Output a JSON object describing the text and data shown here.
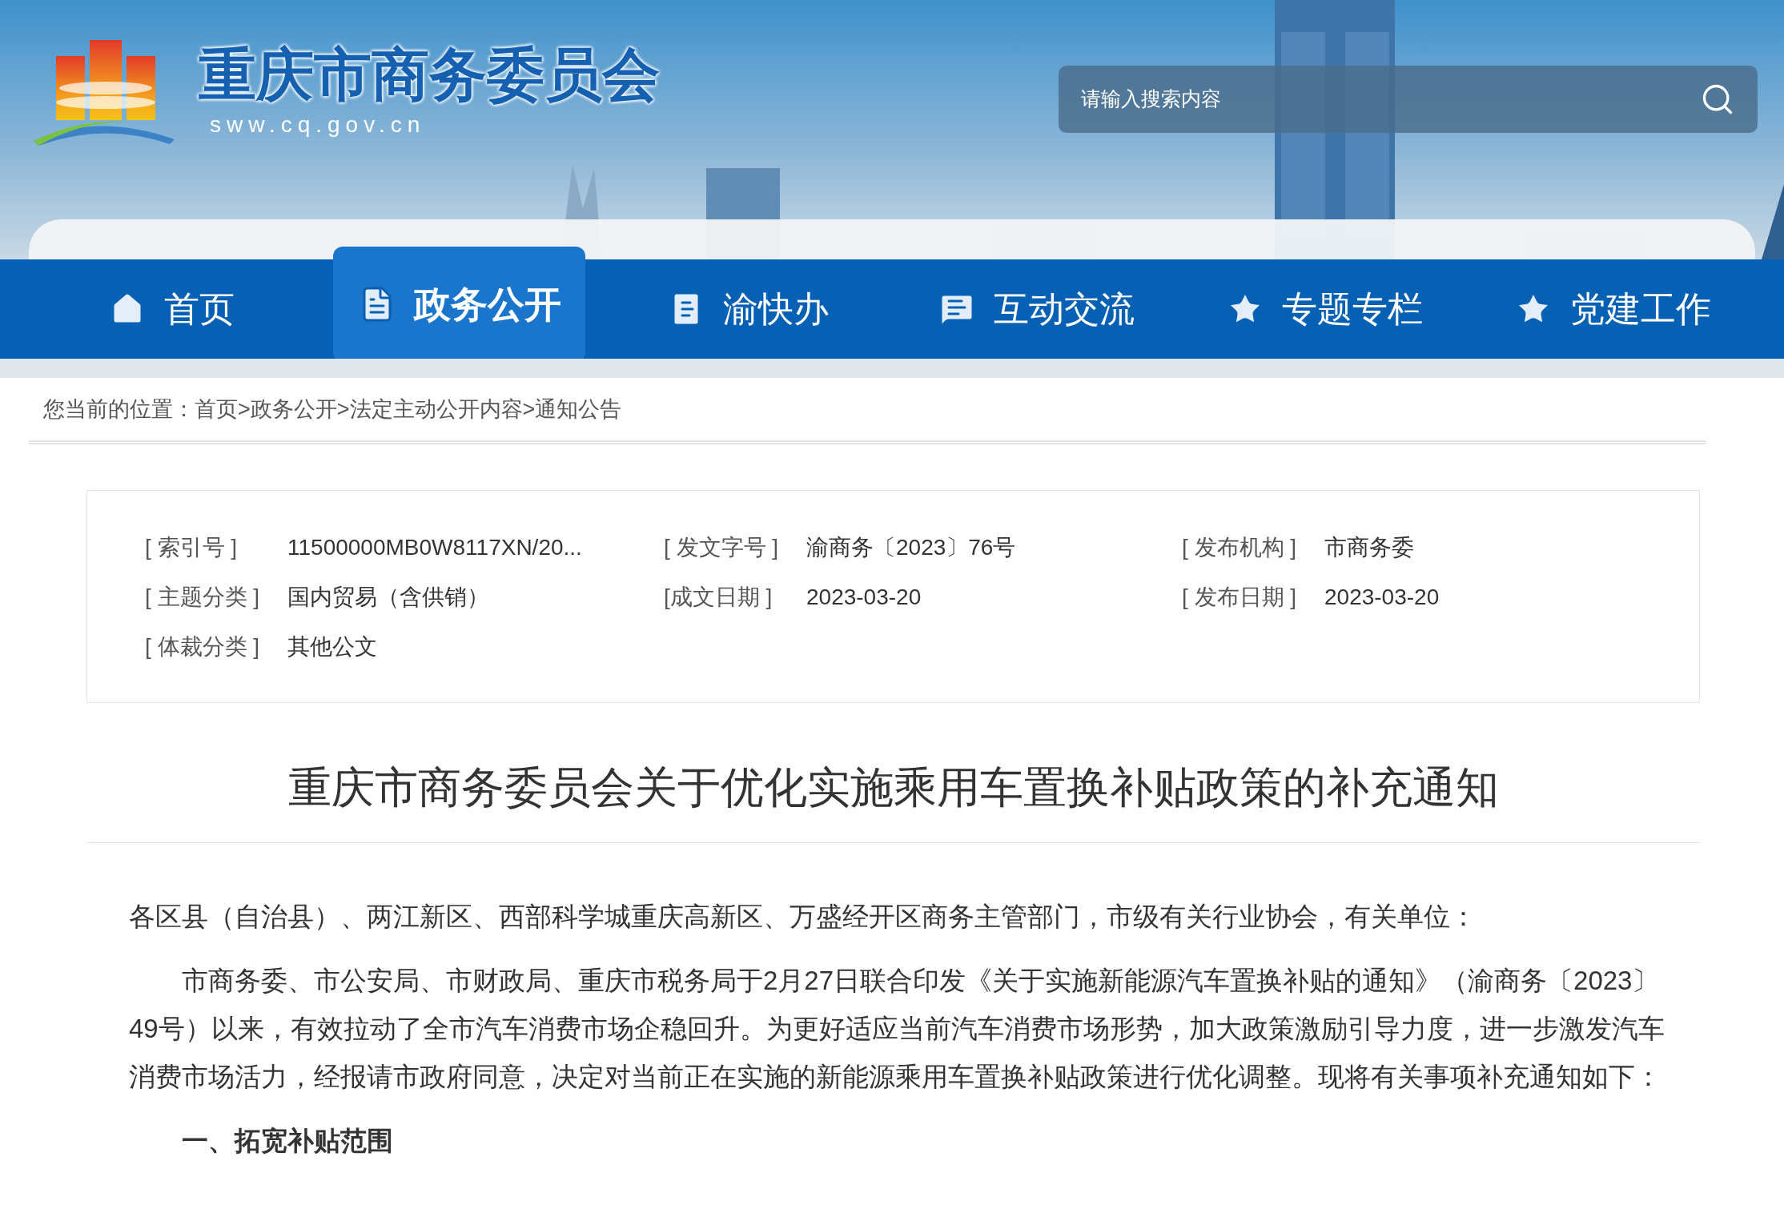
{
  "site": {
    "title": "重庆市商务委员会",
    "url": "sww.cq.gov.cn"
  },
  "search": {
    "placeholder": "请输入搜索内容"
  },
  "nav": [
    {
      "label": "首页",
      "selected": false
    },
    {
      "label": "政务公开",
      "selected": true
    },
    {
      "label": "渝快办",
      "selected": false
    },
    {
      "label": "互动交流",
      "selected": false
    },
    {
      "label": "专题专栏",
      "selected": false
    },
    {
      "label": "党建工作",
      "selected": false
    }
  ],
  "breadcrumb": "您当前的位置：首页>政务公开>法定主动公开内容>通知公告",
  "meta": [
    {
      "label": "[ 索引号 ]",
      "value": "11500000MB0W8117XN/20..."
    },
    {
      "label": "[ 发文字号 ]",
      "value": "渝商务〔2023〕76号"
    },
    {
      "label": "[ 发布机构 ]",
      "value": "市商务委"
    },
    {
      "label": "[ 主题分类 ]",
      "value": "国内贸易（含供销）"
    },
    {
      "label": "[成文日期 ]",
      "value": "2023-03-20"
    },
    {
      "label": "[ 发布日期 ]",
      "value": "2023-03-20"
    },
    {
      "label": "[ 体裁分类 ]",
      "value": "其他公文"
    }
  ],
  "article": {
    "title": "重庆市商务委员会关于优化实施乘用车置换补贴政策的补充通知",
    "paragraphs": [
      {
        "kind": "plain",
        "text": "各区县（自治县）、两江新区、西部科学城重庆高新区、万盛经开区商务主管部门，市级有关行业协会，有关单位："
      },
      {
        "kind": "indented",
        "text": "市商务委、市公安局、市财政局、重庆市税务局于2月27日联合印发《关于实施新能源汽车置换补贴的通知》（渝商务〔2023〕49号）以来，有效拉动了全市汽车消费市场企稳回升。为更好适应当前汽车消费市场形势，加大政策激励引导力度，进一步激发汽车消费市场活力，经报请市政府同意，决定对当前正在实施的新能源乘用车置换补贴政策进行优化调整。现将有关事项补充通知如下："
      },
      {
        "kind": "heading",
        "text": "一、拓宽补贴范围"
      }
    ]
  }
}
